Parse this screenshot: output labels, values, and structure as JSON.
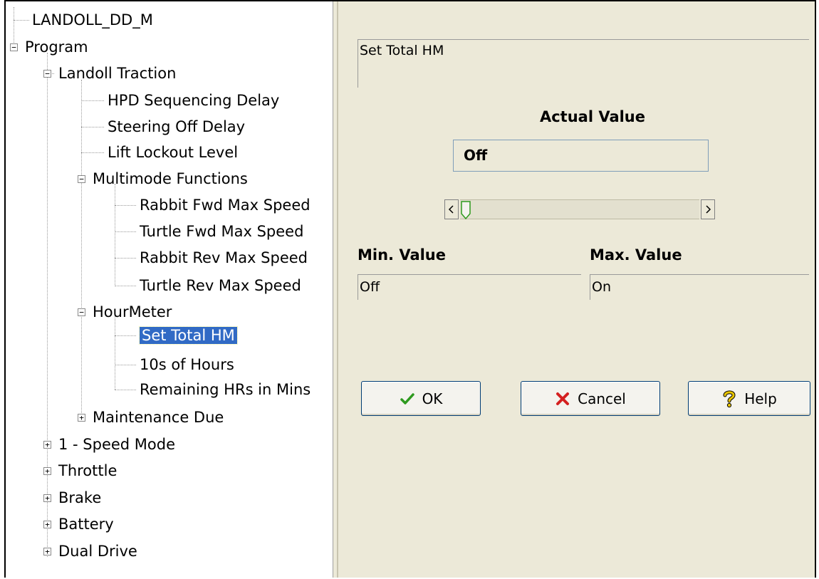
{
  "tree": {
    "items": [
      {
        "label": "LANDOLL_DD_M",
        "expander": ""
      },
      {
        "label": "Program",
        "expander": "−"
      },
      {
        "label": "Landoll Traction",
        "expander": "−"
      },
      {
        "label": "HPD Sequencing Delay",
        "expander": ""
      },
      {
        "label": "Steering Off Delay",
        "expander": ""
      },
      {
        "label": "Lift Lockout Level",
        "expander": ""
      },
      {
        "label": "Multimode Functions",
        "expander": "−"
      },
      {
        "label": "Rabbit Fwd Max Speed",
        "expander": ""
      },
      {
        "label": "Turtle Fwd Max Speed",
        "expander": ""
      },
      {
        "label": "Rabbit Rev Max Speed",
        "expander": ""
      },
      {
        "label": "Turtle Rev Max Speed",
        "expander": ""
      },
      {
        "label": "HourMeter",
        "expander": "−"
      },
      {
        "label": "Set Total HM",
        "expander": "",
        "selected": true
      },
      {
        "label": "10s of Hours",
        "expander": ""
      },
      {
        "label": "Remaining HRs in Mins",
        "expander": ""
      },
      {
        "label": "Maintenance Due",
        "expander": "+"
      },
      {
        "label": "1 - Speed Mode",
        "expander": "+"
      },
      {
        "label": "Throttle",
        "expander": "+"
      },
      {
        "label": "Brake",
        "expander": "+"
      },
      {
        "label": "Battery",
        "expander": "+"
      },
      {
        "label": "Dual Drive",
        "expander": "+"
      }
    ]
  },
  "panel": {
    "description": "Set Total HM",
    "actual_heading": "Actual Value",
    "actual_value": "Off",
    "slider_level": 0,
    "min_label": "Min. Value",
    "min_value": "Off",
    "max_label": "Max. Value",
    "max_value": "On"
  },
  "buttons": {
    "ok": "OK",
    "cancel": "Cancel",
    "help": "Help"
  },
  "icons": {
    "ok": "checkmark-icon",
    "cancel": "red-x-icon",
    "help": "question-mark-icon"
  },
  "colors": {
    "selection": "#316ac5",
    "panel_bg": "#ece9d8",
    "ok_check": "#2e9a1e",
    "cancel_x": "#d42020",
    "help_q": "#e8c400"
  }
}
